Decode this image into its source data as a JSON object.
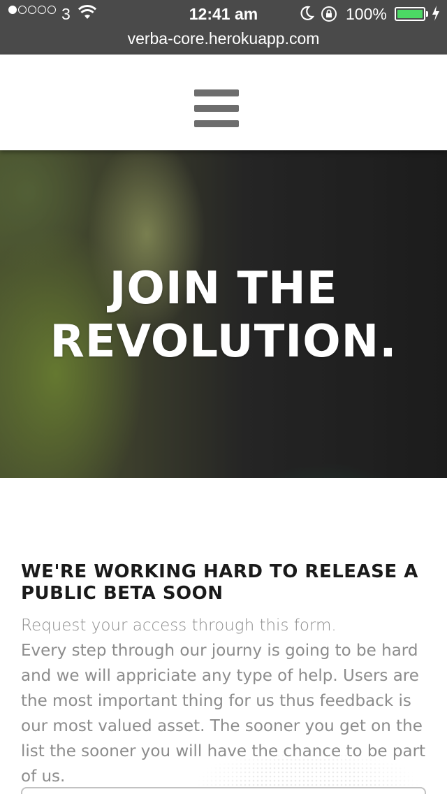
{
  "status_bar": {
    "carrier": "3",
    "time": "12:41 am",
    "battery_percent": "100%",
    "battery_level": 1.0,
    "battery_color": "#4cd964",
    "signal_bars_filled": 1,
    "signal_bars_total": 5
  },
  "browser": {
    "url": "verba-core.herokuapp.com"
  },
  "header": {
    "menu_icon": "hamburger-icon"
  },
  "hero": {
    "title_line1": "JOIN THE",
    "title_line2": "REVOLUTION."
  },
  "content": {
    "section_title": "WE'RE WORKING HARD TO RELEASE A PUBLIC BETA SOON",
    "lead": "Request your access through this form.",
    "body": "Every step through our journy is going to be hard and we will appriciate any type of help. Users are the most important thing for us thus feedback is our most valued asset. The sooner you get on the list the sooner you will have the chance to be part of us."
  },
  "colors": {
    "status_bar_bg": "#4a4a4a",
    "menu_icon": "#6d6d6d",
    "heading": "#1a1a1a",
    "body_text": "#8c8c8c"
  }
}
